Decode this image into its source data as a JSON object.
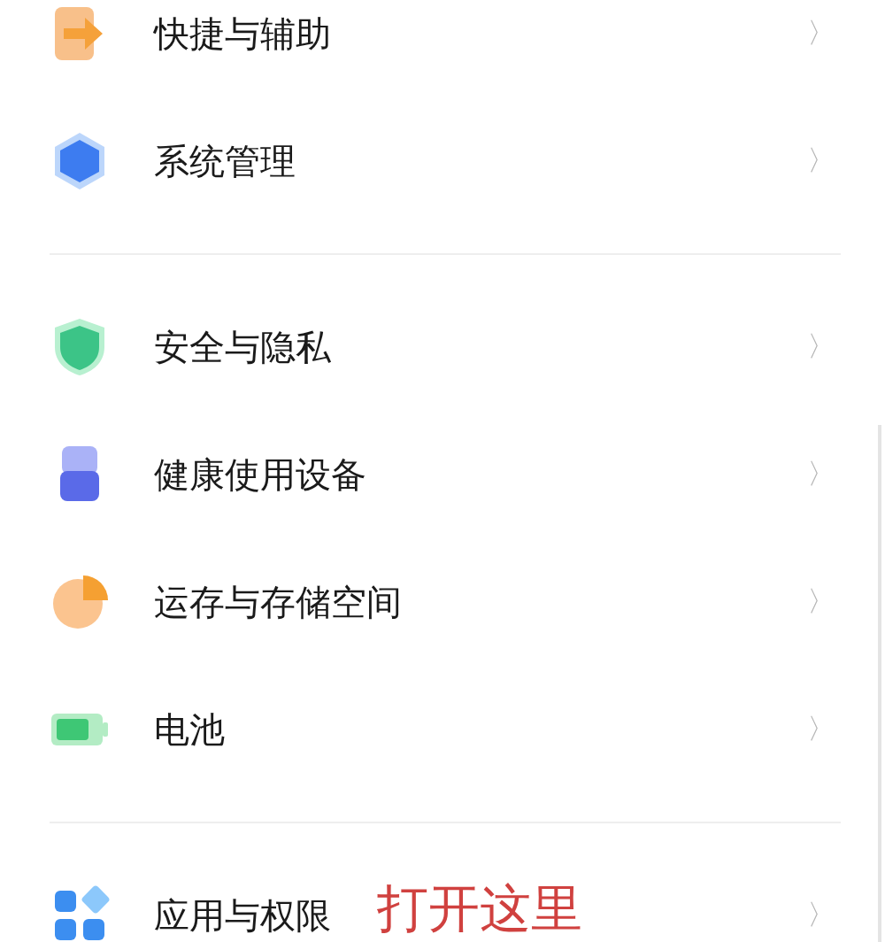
{
  "groups": [
    {
      "items": [
        {
          "kind": "shortcut",
          "label": "快捷与辅助",
          "chevron": "〉"
        },
        {
          "kind": "system",
          "label": "系统管理",
          "chevron": "〉"
        }
      ]
    },
    {
      "items": [
        {
          "kind": "security",
          "label": "安全与隐私",
          "chevron": "〉"
        },
        {
          "kind": "health",
          "label": "健康使用设备",
          "chevron": "〉"
        },
        {
          "kind": "storage",
          "label": "运存与存储空间",
          "chevron": "〉"
        },
        {
          "kind": "battery",
          "label": "电池",
          "chevron": "〉"
        }
      ]
    },
    {
      "items": [
        {
          "kind": "apps",
          "label": "应用与权限",
          "chevron": "〉",
          "annotation": "打开这里"
        }
      ]
    }
  ]
}
